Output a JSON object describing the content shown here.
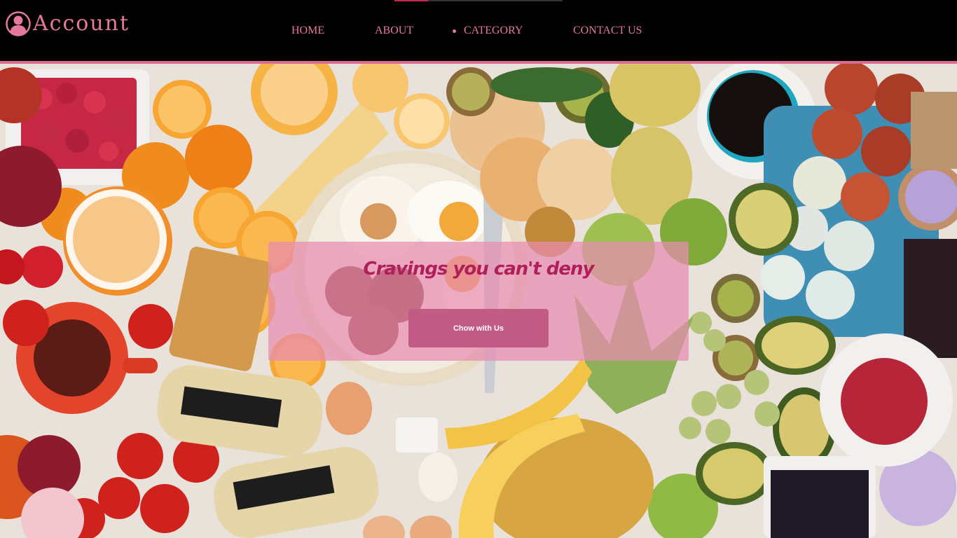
{
  "header": {
    "account_label": "Account",
    "icon": "user-circle-icon"
  },
  "nav": {
    "items": [
      "HOME",
      "ABOUT",
      "CATEGORY",
      "CONTACT US"
    ]
  },
  "hero": {
    "tagline": "Cravings you can't deny",
    "cta_label": "Chow with Us",
    "background": "breakfast-spread-photo"
  },
  "colors": {
    "accent": "#e5789e",
    "tagline": "#b01f5a",
    "button": "#c25c85",
    "header_bg": "#000000"
  }
}
